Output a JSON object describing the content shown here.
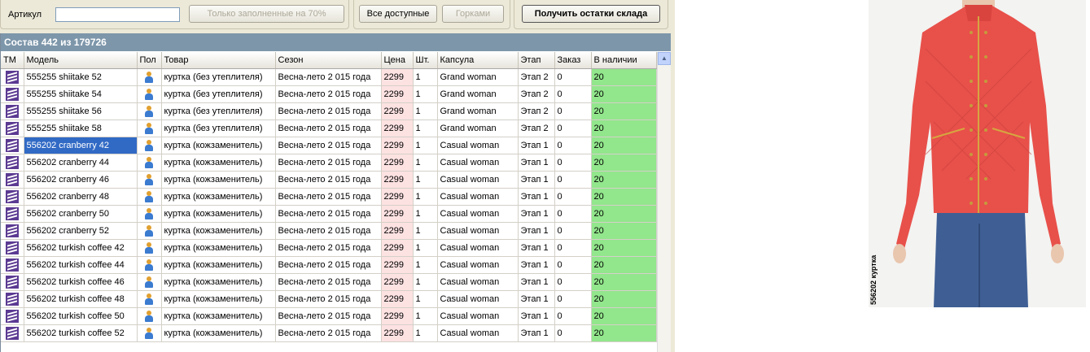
{
  "toolbar": {
    "article_label": "Артикул",
    "article_value": "",
    "filled_button": "Только заполненные на 70%",
    "all_available_button": "Все доступные",
    "slides_button": "Горками",
    "get_stock_button": "Получить остатки склада"
  },
  "grid": {
    "caption": "Состав 442 из 179726",
    "columns": [
      "ТМ",
      "Модель",
      "Пол",
      "Товар",
      "Сезон",
      "Цена",
      "Шт.",
      "Капсула",
      "Этап",
      "Заказ",
      "В наличии"
    ],
    "rows": [
      {
        "model": "555255 shiitake  52",
        "item": "куртка (без утеплителя)",
        "season": "Весна-лето 2 015 года",
        "price": "2299",
        "qty": "1",
        "capsule": "Grand woman",
        "stage": "Этап 2",
        "order": "0",
        "avail": "20"
      },
      {
        "model": "555255 shiitake  54",
        "item": "куртка (без утеплителя)",
        "season": "Весна-лето 2 015 года",
        "price": "2299",
        "qty": "1",
        "capsule": "Grand woman",
        "stage": "Этап 2",
        "order": "0",
        "avail": "20"
      },
      {
        "model": "555255 shiitake  56",
        "item": "куртка (без утеплителя)",
        "season": "Весна-лето 2 015 года",
        "price": "2299",
        "qty": "1",
        "capsule": "Grand woman",
        "stage": "Этап 2",
        "order": "0",
        "avail": "20"
      },
      {
        "model": "555255 shiitake  58",
        "item": "куртка (без утеплителя)",
        "season": "Весна-лето 2 015 года",
        "price": "2299",
        "qty": "1",
        "capsule": "Grand woman",
        "stage": "Этап 2",
        "order": "0",
        "avail": "20"
      },
      {
        "model": "556202 cranberry  42",
        "item": "куртка (кожзаменитель)",
        "season": "Весна-лето 2 015 года",
        "price": "2299",
        "qty": "1",
        "capsule": "Casual woman",
        "stage": "Этап 1",
        "order": "0",
        "avail": "20",
        "selected": true
      },
      {
        "model": "556202 cranberry  44",
        "item": "куртка (кожзаменитель)",
        "season": "Весна-лето 2 015 года",
        "price": "2299",
        "qty": "1",
        "capsule": "Casual woman",
        "stage": "Этап 1",
        "order": "0",
        "avail": "20"
      },
      {
        "model": "556202 cranberry  46",
        "item": "куртка (кожзаменитель)",
        "season": "Весна-лето 2 015 года",
        "price": "2299",
        "qty": "1",
        "capsule": "Casual woman",
        "stage": "Этап 1",
        "order": "0",
        "avail": "20"
      },
      {
        "model": "556202 cranberry  48",
        "item": "куртка (кожзаменитель)",
        "season": "Весна-лето 2 015 года",
        "price": "2299",
        "qty": "1",
        "capsule": "Casual woman",
        "stage": "Этап 1",
        "order": "0",
        "avail": "20"
      },
      {
        "model": "556202 cranberry  50",
        "item": "куртка (кожзаменитель)",
        "season": "Весна-лето 2 015 года",
        "price": "2299",
        "qty": "1",
        "capsule": "Casual woman",
        "stage": "Этап 1",
        "order": "0",
        "avail": "20"
      },
      {
        "model": "556202 cranberry  52",
        "item": "куртка (кожзаменитель)",
        "season": "Весна-лето 2 015 года",
        "price": "2299",
        "qty": "1",
        "capsule": "Casual woman",
        "stage": "Этап 1",
        "order": "0",
        "avail": "20"
      },
      {
        "model": "556202 turkish coffee  42",
        "item": "куртка (кожзаменитель)",
        "season": "Весна-лето 2 015 года",
        "price": "2299",
        "qty": "1",
        "capsule": "Casual woman",
        "stage": "Этап 1",
        "order": "0",
        "avail": "20"
      },
      {
        "model": "556202 turkish coffee  44",
        "item": "куртка (кожзаменитель)",
        "season": "Весна-лето 2 015 года",
        "price": "2299",
        "qty": "1",
        "capsule": "Casual woman",
        "stage": "Этап 1",
        "order": "0",
        "avail": "20"
      },
      {
        "model": "556202 turkish coffee  46",
        "item": "куртка (кожзаменитель)",
        "season": "Весна-лето 2 015 года",
        "price": "2299",
        "qty": "1",
        "capsule": "Casual woman",
        "stage": "Этап 1",
        "order": "0",
        "avail": "20"
      },
      {
        "model": "556202 turkish coffee  48",
        "item": "куртка (кожзаменитель)",
        "season": "Весна-лето 2 015 года",
        "price": "2299",
        "qty": "1",
        "capsule": "Casual woman",
        "stage": "Этап 1",
        "order": "0",
        "avail": "20"
      },
      {
        "model": "556202 turkish coffee  50",
        "item": "куртка (кожзаменитель)",
        "season": "Весна-лето 2 015 года",
        "price": "2299",
        "qty": "1",
        "capsule": "Casual woman",
        "stage": "Этап 1",
        "order": "0",
        "avail": "20"
      },
      {
        "model": "556202 turkish coffee  52",
        "item": "куртка (кожзаменитель)",
        "season": "Весна-лето 2 015 года",
        "price": "2299",
        "qty": "1",
        "capsule": "Casual woman",
        "stage": "Этап 1",
        "order": "0",
        "avail": "20"
      }
    ]
  },
  "colors": {
    "price_bg": "#fde2e2",
    "avail_bg": "#92e68c",
    "selection": "#316ac5",
    "caption_bg": "#7d96aa",
    "jacket": "#e8504a"
  },
  "photo": {
    "caption": "556202 куртка"
  }
}
